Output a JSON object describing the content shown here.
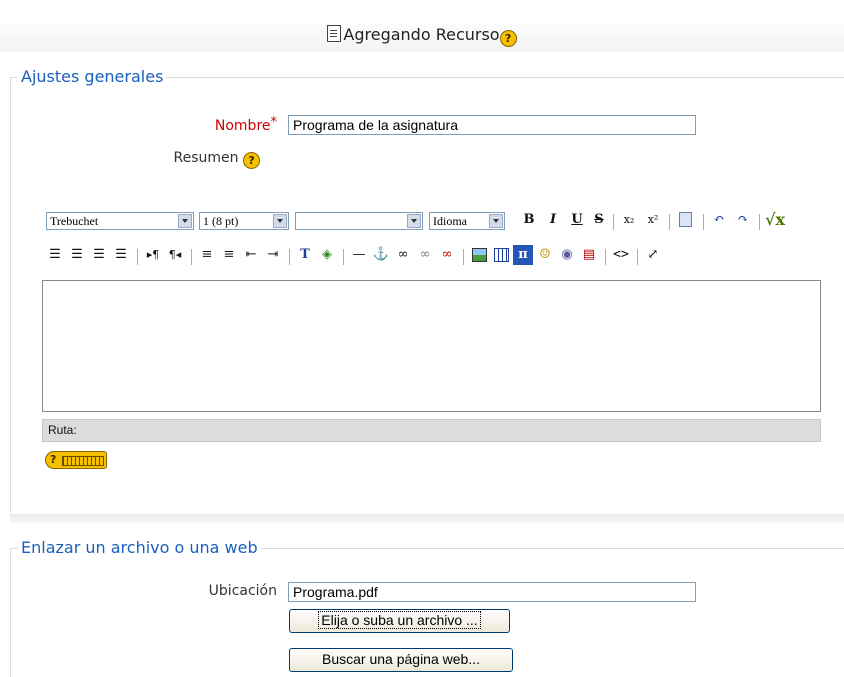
{
  "page": {
    "title": "Agregando Recurso"
  },
  "general": {
    "legend": "Ajustes generales",
    "name_label": "Nombre",
    "name_required_mark": "*",
    "name_value": "Programa de la asignatura",
    "summary_label": "Resumen"
  },
  "editor": {
    "font_family": "Trebuchet",
    "font_size": "1 (8 pt)",
    "format": "",
    "language": "Idioma",
    "toolbar_row1_icons": [
      "bold-icon",
      "italic-icon",
      "underline-icon",
      "strikethrough-icon",
      "subscript-icon",
      "superscript-icon",
      "paste-word-icon",
      "undo-icon",
      "redo-icon",
      "tex-icon"
    ],
    "toolbar_row2_icons": [
      "align-left-icon",
      "align-center-icon",
      "align-right-icon",
      "justify-icon",
      "ltr-icon",
      "rtl-icon",
      "ordered-list-icon",
      "unordered-list-icon",
      "outdent-icon",
      "indent-icon",
      "text-color-icon",
      "background-color-icon",
      "horizontal-rule-icon",
      "anchor-icon",
      "link-icon",
      "unlink-icon",
      "prevent-link-icon",
      "image-icon",
      "table-icon",
      "equation-icon",
      "smiley-icon",
      "special-char-icon",
      "search-replace-icon",
      "html-source-icon",
      "fullscreen-icon"
    ],
    "path_label": "Ruta:"
  },
  "link": {
    "legend": "Enlazar un archivo o una web",
    "location_label": "Ubicación",
    "location_value": "Programa.pdf",
    "choose_file_button": "Elija o suba un archivo ...",
    "search_web_button": "Buscar una página web..."
  }
}
